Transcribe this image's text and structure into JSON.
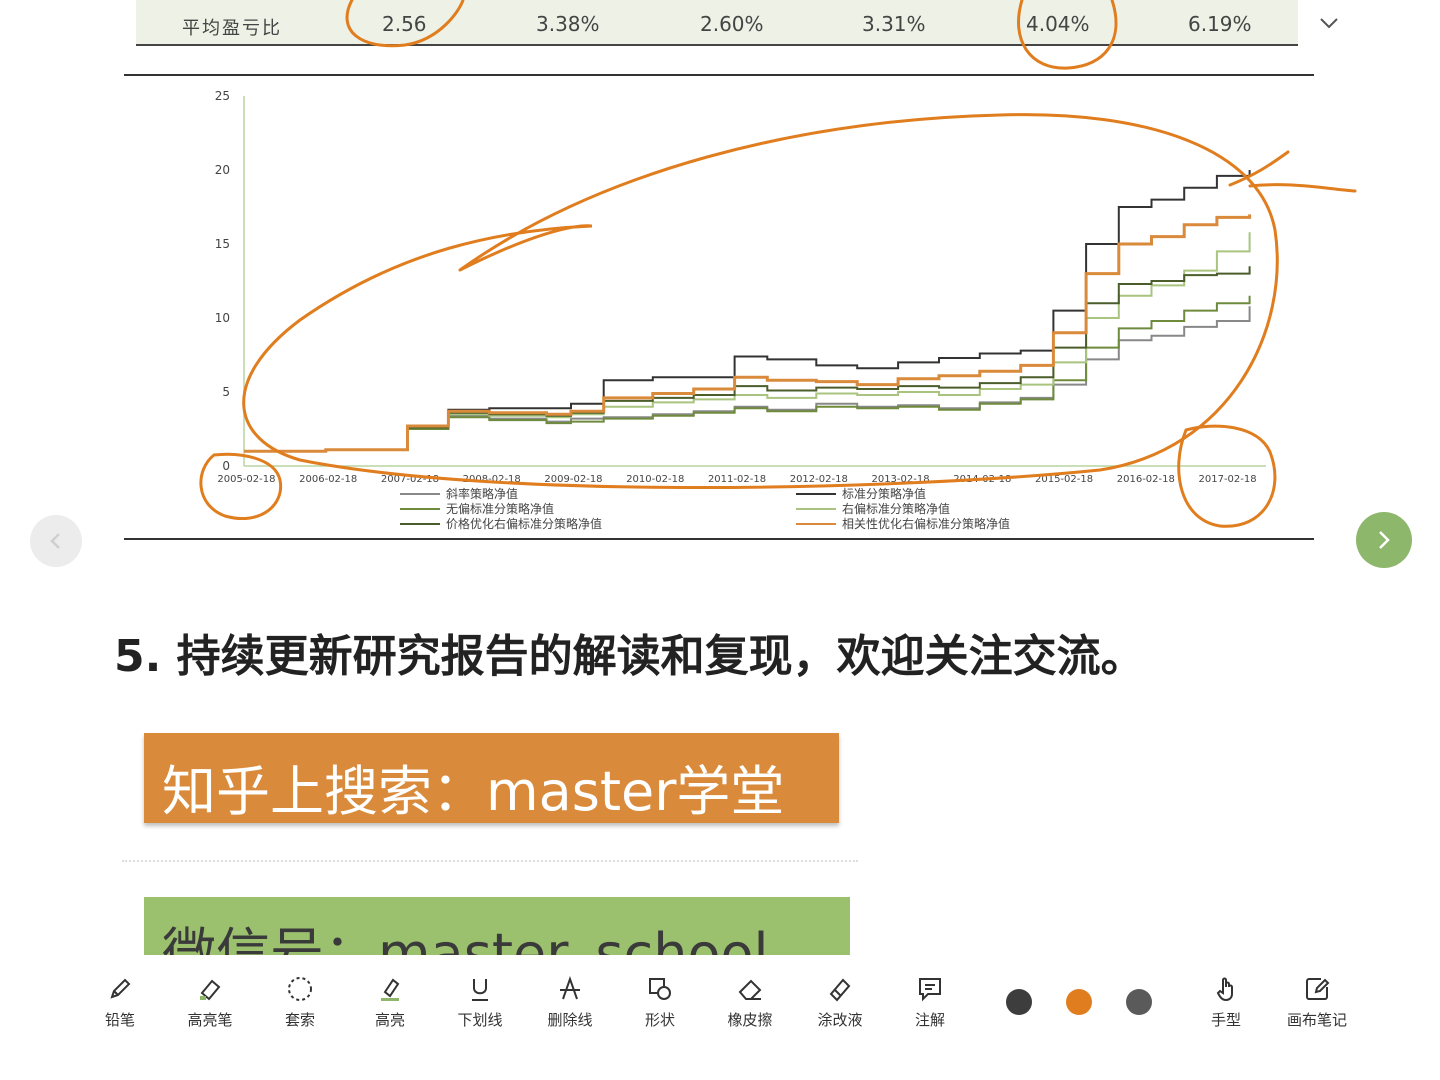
{
  "table": {
    "row_label": "平均盈亏比",
    "values": [
      "2.56",
      "3.38%",
      "2.60%",
      "3.31%",
      "4.04%",
      "6.19%"
    ]
  },
  "chart_data": {
    "type": "line",
    "ylim": [
      0,
      25
    ],
    "yticks": [
      "0",
      "5",
      "10",
      "15",
      "20",
      "25"
    ],
    "xticks": [
      "2005-02-18",
      "2006-02-18",
      "2007-02-18",
      "2008-02-18",
      "2009-02-18",
      "2010-02-18",
      "2011-02-18",
      "2012-02-18",
      "2013-02-18",
      "2014-02-18",
      "2015-02-18",
      "2016-02-18",
      "2017-02-18"
    ],
    "x": [
      2005.1,
      2006.1,
      2007.1,
      2007.6,
      2008.1,
      2008.8,
      2009.1,
      2009.5,
      2010.1,
      2010.6,
      2011.1,
      2011.5,
      2012.1,
      2012.6,
      2013.1,
      2013.6,
      2014.1,
      2014.6,
      2015.0,
      2015.4,
      2015.8,
      2016.2,
      2016.6,
      2017.0,
      2017.4
    ],
    "series": [
      {
        "name": "斜率策略净值",
        "color": "#888888",
        "values": [
          1.0,
          1.1,
          2.6,
          3.4,
          3.2,
          3.0,
          3.2,
          3.3,
          3.5,
          3.7,
          4.0,
          3.8,
          4.2,
          4.0,
          4.1,
          3.9,
          4.3,
          4.6,
          5.5,
          7.2,
          8.5,
          8.8,
          9.4,
          9.8,
          10.8
        ]
      },
      {
        "name": "标准分策略净值",
        "color": "#333333",
        "values": [
          1.0,
          1.1,
          2.7,
          3.8,
          3.9,
          3.9,
          4.2,
          5.8,
          6.0,
          6.0,
          7.4,
          7.2,
          6.8,
          6.6,
          7.0,
          7.3,
          7.6,
          7.8,
          10.5,
          15.0,
          17.5,
          18.0,
          18.8,
          19.6,
          20.0
        ]
      },
      {
        "name": "无偏标准分策略净值",
        "color": "#6e8b3d",
        "values": [
          1.0,
          1.1,
          2.5,
          3.3,
          3.1,
          2.9,
          3.0,
          3.2,
          3.4,
          3.6,
          3.9,
          3.7,
          4.0,
          3.9,
          4.0,
          3.8,
          4.2,
          4.5,
          5.8,
          8.0,
          9.3,
          9.8,
          10.5,
          11.0,
          11.5
        ]
      },
      {
        "name": "右偏标准分策略净值",
        "color": "#a9c47f",
        "values": [
          1.0,
          1.1,
          2.6,
          3.5,
          3.4,
          3.3,
          3.5,
          4.0,
          4.3,
          4.5,
          4.8,
          4.6,
          4.9,
          4.8,
          5.0,
          4.8,
          5.2,
          5.5,
          7.0,
          10.0,
          11.5,
          12.2,
          13.2,
          14.5,
          15.8
        ]
      },
      {
        "name": "价格优化右偏标准分策略净值",
        "color": "#4a5d2a",
        "values": [
          1.0,
          1.1,
          2.6,
          3.6,
          3.5,
          3.4,
          3.6,
          4.4,
          4.6,
          4.8,
          5.4,
          5.1,
          5.3,
          5.2,
          5.4,
          5.3,
          5.6,
          6.0,
          8.0,
          11.0,
          12.3,
          12.5,
          12.9,
          13.0,
          13.5
        ]
      },
      {
        "name": "相关性优化右偏标准分策略净值",
        "color": "#d98a3a",
        "values": [
          1.0,
          1.1,
          2.7,
          3.7,
          3.6,
          3.5,
          3.7,
          4.6,
          4.9,
          5.2,
          6.0,
          5.8,
          5.7,
          5.5,
          5.9,
          6.1,
          6.4,
          6.8,
          9.0,
          13.0,
          15.0,
          15.5,
          16.3,
          16.8,
          17.0
        ]
      }
    ]
  },
  "nav": {
    "prev_icon": "chevron-left-icon",
    "next_icon": "chevron-right-icon"
  },
  "content": {
    "heading": "5. 持续更新研究报告的解读和复现，欢迎关注交流。",
    "zhihu": "知乎上搜索：master学堂",
    "wechat": "微信号：master_school"
  },
  "toolbar": {
    "tools": [
      {
        "label": "铅笔",
        "icon": "pencil-icon"
      },
      {
        "label": "高亮笔",
        "icon": "highlighter-pen-icon"
      },
      {
        "label": "套索",
        "icon": "lasso-icon"
      },
      {
        "label": "高亮",
        "icon": "highlight-icon"
      },
      {
        "label": "下划线",
        "icon": "underline-icon"
      },
      {
        "label": "删除线",
        "icon": "strikethrough-icon"
      },
      {
        "label": "形状",
        "icon": "shape-icon"
      },
      {
        "label": "橡皮擦",
        "icon": "eraser-icon"
      },
      {
        "label": "涂改液",
        "icon": "correction-fluid-icon"
      },
      {
        "label": "注解",
        "icon": "comment-icon"
      },
      {
        "label": "手型",
        "icon": "hand-icon"
      },
      {
        "label": "画布笔记",
        "icon": "canvas-note-icon"
      }
    ],
    "colors": [
      "#3d3d3d",
      "#e07d1e",
      "#5a5a5a"
    ]
  }
}
